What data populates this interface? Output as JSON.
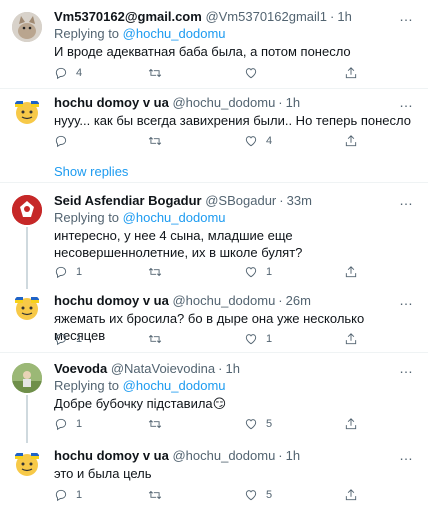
{
  "tweets": [
    {
      "name": "Vm5370162@gmail.com",
      "handle": "@Vm5370162gmail1",
      "time": "1h",
      "replying_label": "Replying to",
      "replying_to": "@hochu_dodomu",
      "text": "И вроде адекватная баба была, а потом понесло",
      "replies": "4",
      "retweets": "",
      "likes": "",
      "avatar": "cat-avatar"
    },
    {
      "name": "hochu domoy v ua",
      "handle": "@hochu_dodomu",
      "time": "1h",
      "text": "нууу... как бы всегда завихрения были.. Но теперь понесло",
      "replies": "",
      "retweets": "",
      "likes": "4",
      "avatar": "emoji-flag-avatar"
    },
    {
      "name": "Seid Asfendiar Bogadur",
      "handle": "@SBogadur",
      "time": "33m",
      "replying_label": "Replying to",
      "replying_to": "@hochu_dodomu",
      "text": "интересно, у нее 4 сына, младшие еще несовершеннолетние, их в школе булят?",
      "replies": "1",
      "retweets": "",
      "likes": "1",
      "avatar": "emblem-avatar"
    },
    {
      "name": "hochu domoy v ua",
      "handle": "@hochu_dodomu",
      "time": "26m",
      "text": "яжемать их бросила? бо в дыре она уже несколько месяцев",
      "replies": "1",
      "retweets": "",
      "likes": "1",
      "avatar": "emoji-flag-avatar"
    },
    {
      "name": "Voevoda",
      "handle": "@NataVoievodina",
      "time": "1h",
      "replying_label": "Replying to",
      "replying_to": "@hochu_dodomu",
      "text": "Добре бубочку підставила😏",
      "replies": "1",
      "retweets": "",
      "likes": "5",
      "avatar": "photo-avatar"
    },
    {
      "name": "hochu domoy v ua",
      "handle": "@hochu_dodomu",
      "time": "1h",
      "text": "это и была цель",
      "replies": "1",
      "retweets": "",
      "likes": "5",
      "avatar": "emoji-flag-avatar"
    }
  ],
  "show_replies": "Show replies",
  "more_icon": "…",
  "colors": {
    "link": "#1d9bf0",
    "muted": "#536471",
    "border": "#eff3f4"
  }
}
